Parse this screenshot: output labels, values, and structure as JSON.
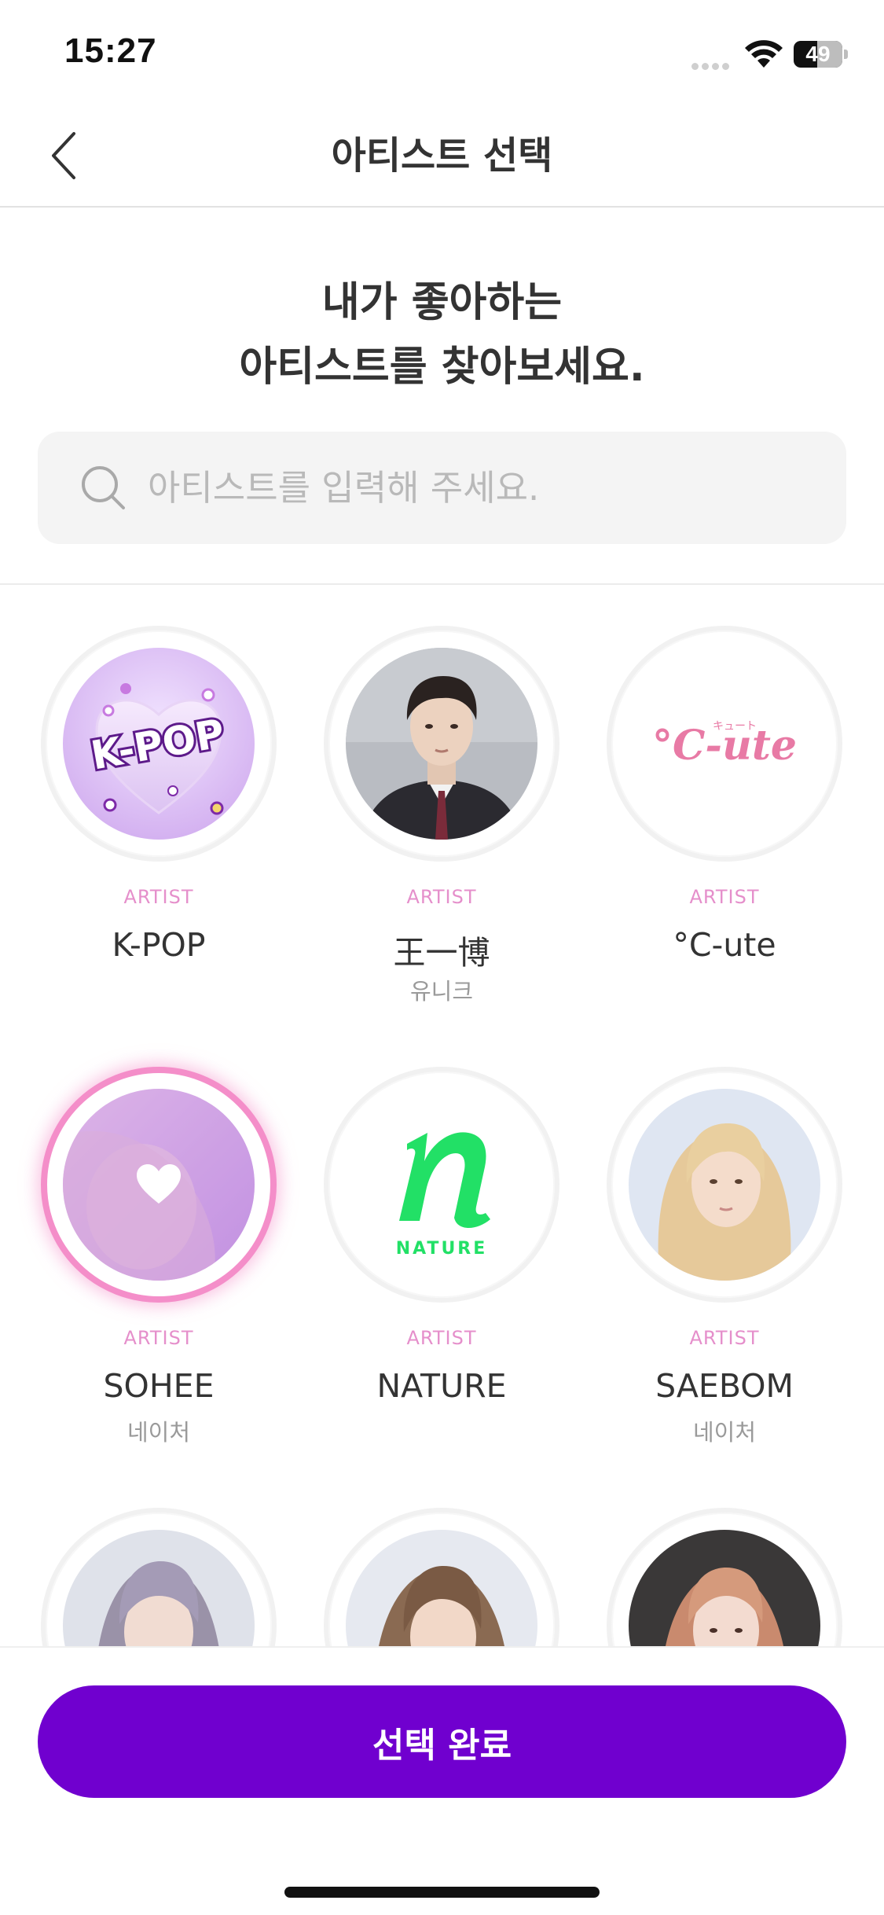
{
  "status_bar": {
    "time": "15:27",
    "battery": "49",
    "battery_level": 0.49
  },
  "nav": {
    "title": "아티스트 선택",
    "back_icon": "chevron-left-icon"
  },
  "headline": {
    "line1": "내가 좋아하는",
    "line2": "아티스트를 찾아보세요."
  },
  "search": {
    "placeholder": "아티스트를 입력해 주세요.",
    "value": "",
    "icon": "search-icon"
  },
  "artists": [
    {
      "type": "ARTIST",
      "name": "K-POP",
      "group": "",
      "selected": false,
      "logo_text": "K-POP"
    },
    {
      "type": "ARTIST",
      "name": "王一博",
      "group": "유니크",
      "selected": false
    },
    {
      "type": "ARTIST",
      "name": "°C-ute",
      "group": "",
      "selected": false,
      "logo_text": "°C-ute",
      "logo_small_text": "キュート"
    },
    {
      "type": "ARTIST",
      "name": "SOHEE",
      "group": "네이처",
      "selected": true,
      "selected_icon": "heart-icon"
    },
    {
      "type": "ARTIST",
      "name": "NATURE",
      "group": "",
      "selected": false,
      "logo_text": "NATURE"
    },
    {
      "type": "ARTIST",
      "name": "SAEBOM",
      "group": "네이처",
      "selected": false
    },
    {
      "type": "",
      "name": "",
      "group": "",
      "selected": false
    },
    {
      "type": "",
      "name": "",
      "group": "",
      "selected": false
    },
    {
      "type": "",
      "name": "",
      "group": "",
      "selected": false
    }
  ],
  "footer": {
    "confirm_label": "선택 완료"
  },
  "colors": {
    "accent": "#7000cf",
    "artist_label": "#e58fcb",
    "selected_ring": "#f48ec9",
    "nature_green": "#22e066"
  }
}
